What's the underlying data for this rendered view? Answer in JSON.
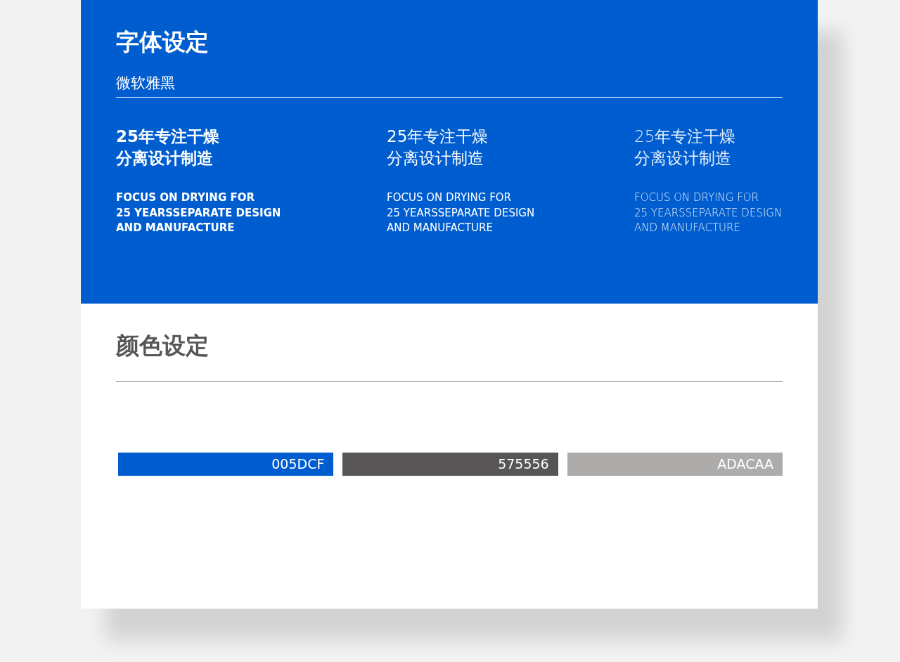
{
  "font_section": {
    "title": "字体设定",
    "font_name": "微软雅黑",
    "samples": [
      {
        "kind": "bold",
        "cn_lines": [
          "25年专注干燥",
          "分离设计制造"
        ],
        "en_lines": [
          "FOCUS ON DRYING FOR",
          "25 YEARSSEPARATE DESIGN",
          "AND MANUFACTURE"
        ]
      },
      {
        "kind": "regular",
        "cn_lines": [
          "25年专注干燥",
          "分离设计制造"
        ],
        "en_lines": [
          "FOCUS ON DRYING FOR",
          "25 YEARSSEPARATE DESIGN",
          "AND MANUFACTURE"
        ]
      },
      {
        "kind": "light",
        "cn_lines": [
          "25年专注干燥",
          "分离设计制造"
        ],
        "en_lines": [
          "FOCUS ON DRYING FOR",
          "25 YEARSSEPARATE DESIGN",
          "AND MANUFACTURE"
        ]
      }
    ]
  },
  "color_section": {
    "title": "颜色设定",
    "swatches": [
      {
        "label": "005DCF",
        "color": "#005dcf"
      },
      {
        "label": "575556",
        "color": "#575556"
      },
      {
        "label": "ADACAA",
        "color": "#adacaa"
      }
    ]
  }
}
